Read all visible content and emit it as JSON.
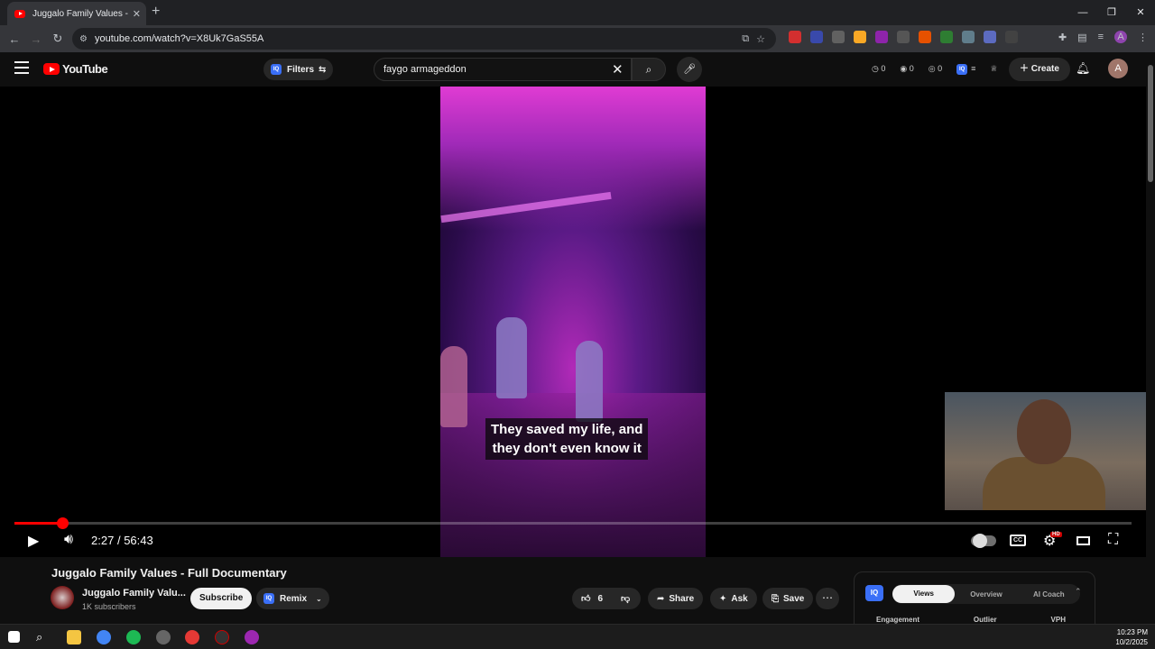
{
  "browser": {
    "tab_title": "Juggalo Family Values - Full Do",
    "url": "youtube.com/watch?v=X8Uk7GaS55A",
    "accent": "#35363a"
  },
  "youtube": {
    "logo_text": "YouTube",
    "filters_label": "Filters",
    "search_value": "faygo armageddon",
    "stats": [
      "0",
      "0",
      "0"
    ],
    "create_label": "Create",
    "account_initial": "A",
    "brand_color": "#ff0000"
  },
  "player": {
    "caption_line1": "They saved my life, and",
    "caption_line2": "they don't even know it",
    "time_current": "2:27",
    "time_separator": "/",
    "time_total": "56:43",
    "progress_fraction": 0.043
  },
  "video": {
    "title": "Juggalo Family Values - Full Documentary",
    "channel_name": "Juggalo Family Valu...",
    "subscribers": "1K subscribers",
    "subscribe_label": "Subscribe",
    "remix_label": "Remix",
    "like_count": "6",
    "share_label": "Share",
    "ask_label": "Ask",
    "save_label": "Save"
  },
  "iq_panel": {
    "logo": "IQ",
    "tabs": [
      "Views",
      "Overview",
      "AI Coach"
    ],
    "active_tab": 0,
    "columns": [
      "Engagement",
      "Outlier",
      "VPH"
    ]
  },
  "taskbar": {
    "time": "10:23 PM",
    "date": "10/2/2025"
  }
}
